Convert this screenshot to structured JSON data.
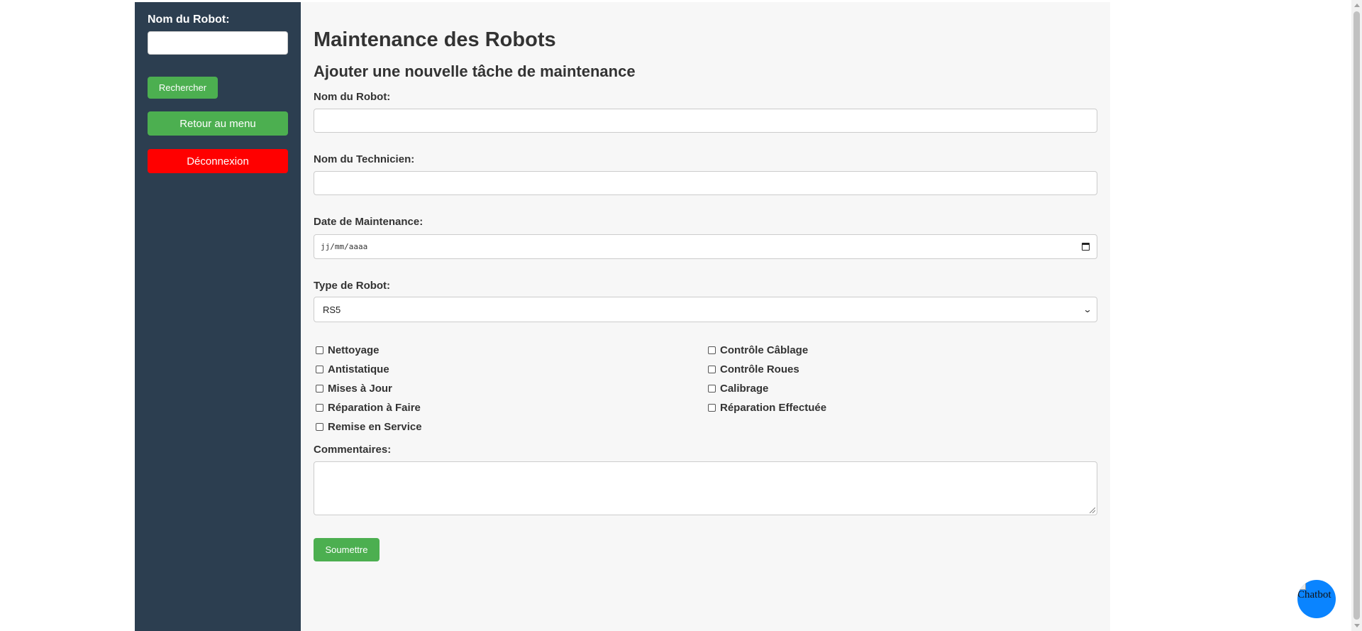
{
  "sidebar": {
    "search_label": "Nom du Robot:",
    "search_value": "",
    "search_button": "Rechercher",
    "menu_button": "Retour au menu",
    "logout_button": "Déconnexion"
  },
  "main": {
    "title": "Maintenance des Robots",
    "subtitle": "Ajouter une nouvelle tâche de maintenance",
    "robot_name_label": "Nom du Robot:",
    "robot_name_value": "",
    "technician_label": "Nom du Technicien:",
    "technician_value": "",
    "date_label": "Date de Maintenance:",
    "date_placeholder": "jj/mm/aaaa",
    "robot_type_label": "Type de Robot:",
    "robot_type_selected": "RS5",
    "checkboxes": [
      {
        "label": "Nettoyage",
        "checked": false
      },
      {
        "label": "Contrôle Câblage",
        "checked": false
      },
      {
        "label": "Antistatique",
        "checked": false
      },
      {
        "label": "Contrôle Roues",
        "checked": false
      },
      {
        "label": "Mises à Jour",
        "checked": false
      },
      {
        "label": "Calibrage",
        "checked": false
      },
      {
        "label": "Réparation à Faire",
        "checked": false
      },
      {
        "label": "Réparation Effectuée",
        "checked": false
      },
      {
        "label": "Remise en Service",
        "checked": false
      }
    ],
    "comments_label": "Commentaires:",
    "comments_value": "",
    "submit_button": "Soumettre"
  },
  "chatbot": {
    "alt_text": "Chatbot",
    "color": "#0a84ff"
  },
  "colors": {
    "sidebar_bg": "#2c3e50",
    "main_bg": "#f7f7f7",
    "green": "#4caf50",
    "red": "#ff0000"
  }
}
